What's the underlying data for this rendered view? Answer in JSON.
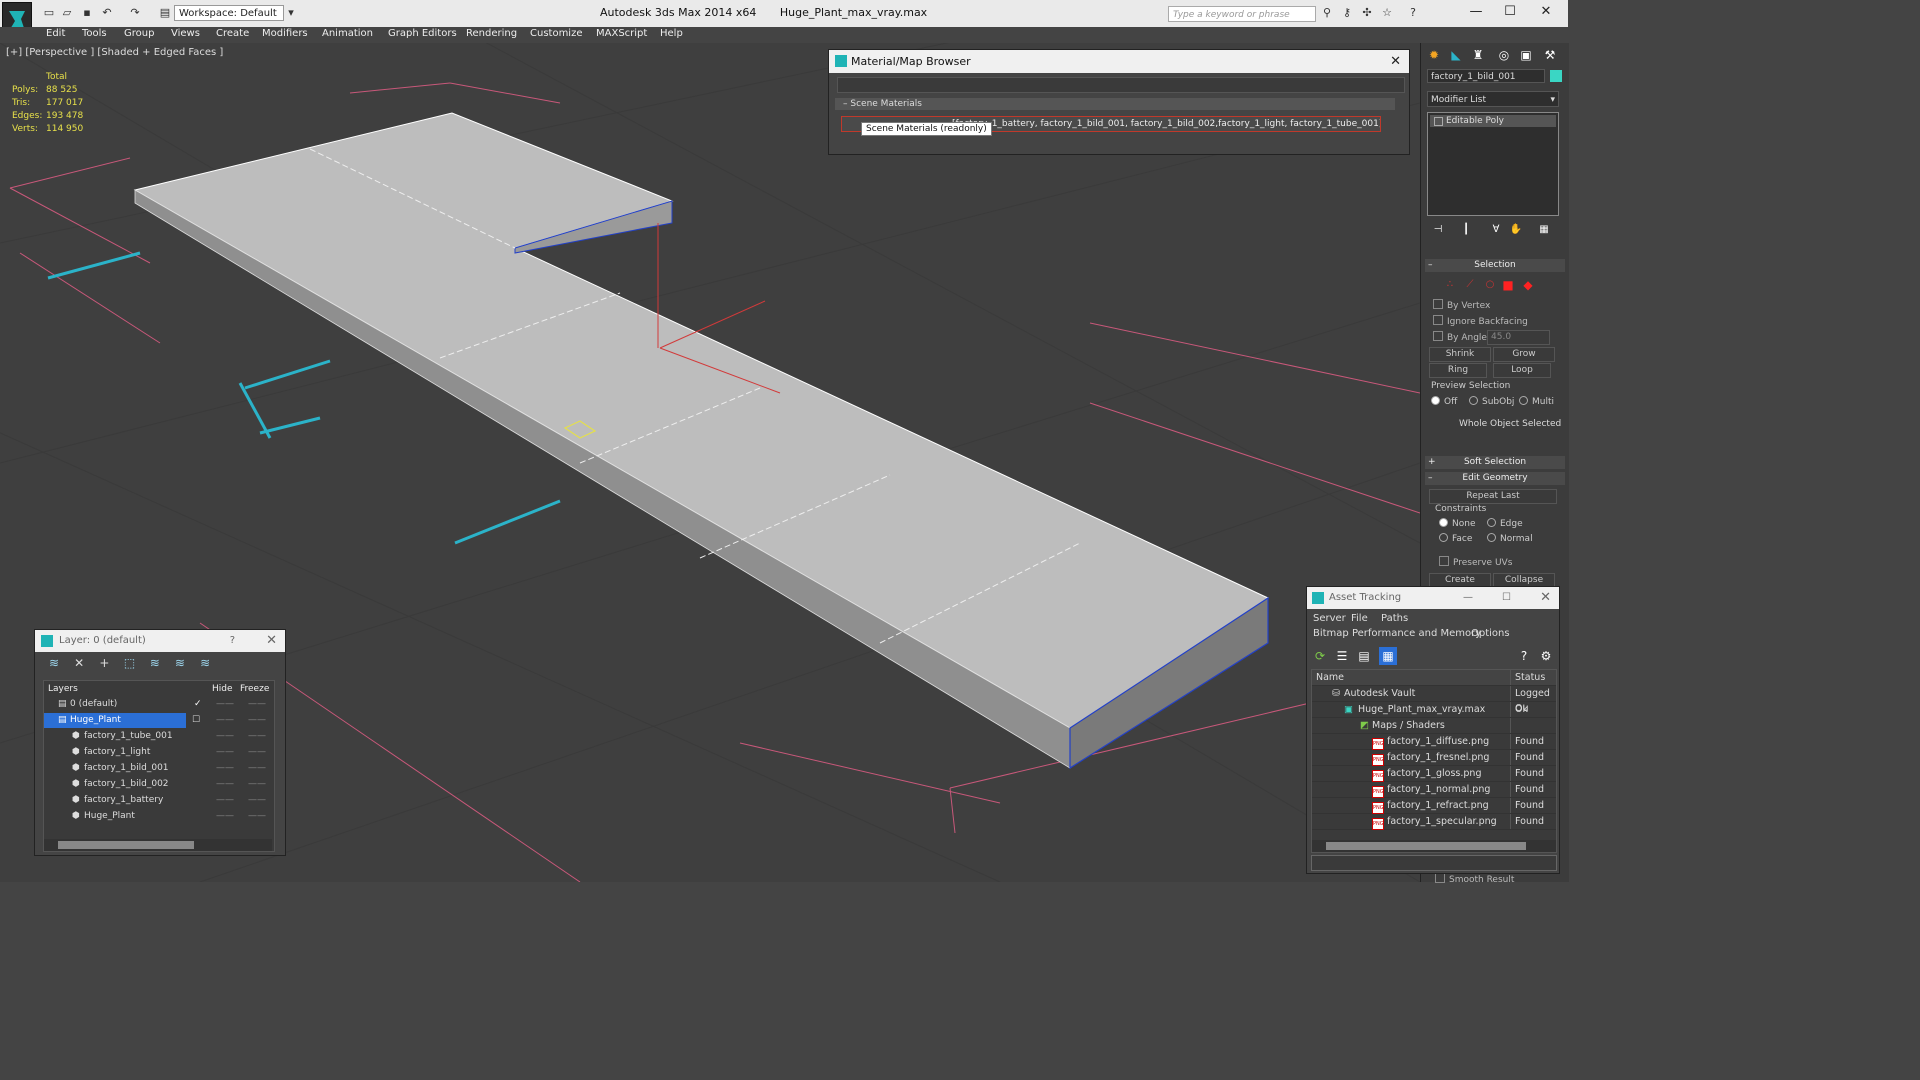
{
  "titlebar": {
    "app_title": "Autodesk 3ds Max  2014 x64",
    "file_title": "Huge_Plant_max_vray.max",
    "workspace": "Workspace: Default",
    "search_placeholder": "Type a keyword or phrase"
  },
  "menu": [
    "Edit",
    "Tools",
    "Group",
    "Views",
    "Create",
    "Modifiers",
    "Animation",
    "Graph Editors",
    "Rendering",
    "Customize",
    "MAXScript",
    "Help"
  ],
  "viewport": {
    "label": "[+] [Perspective ] [Shaded + Edged Faces ]",
    "stats": {
      "header": "Total",
      "rows": [
        {
          "k": "Polys:",
          "v": "88 525"
        },
        {
          "k": "Tris:",
          "v": "177 017"
        },
        {
          "k": "Edges:",
          "v": "193 478"
        },
        {
          "k": "Verts:",
          "v": "114 950"
        }
      ]
    }
  },
  "material_browser": {
    "title": "Material/Map Browser",
    "section": "Scene Materials",
    "row_text": "[factory_1_battery, factory_1_bild_001, factory_1_bild_002,factory_1_light, factory_1_tube_001]",
    "tooltip": "Scene Materials (readonly)"
  },
  "command_panel": {
    "object_name": "factory_1_bild_001",
    "modifier_list": "Modifier List",
    "modifier_stack": [
      "Editable Poly"
    ],
    "selection": {
      "title": "Selection",
      "by_vertex": "By Vertex",
      "ignore_backfacing": "Ignore Backfacing",
      "by_angle": "By Angle:",
      "angle_value": "45.0",
      "shrink": "Shrink",
      "grow": "Grow",
      "ring": "Ring",
      "loop": "Loop",
      "preview_selection": "Preview Selection",
      "off": "Off",
      "subobj": "SubObj",
      "multi": "Multi",
      "status": "Whole Object Selected"
    },
    "soft_selection": "Soft Selection",
    "edit_geometry": {
      "title": "Edit Geometry",
      "repeat_last": "Repeat Last",
      "constraints": "Constraints",
      "none": "None",
      "edge": "Edge",
      "face": "Face",
      "normal": "Normal",
      "preserve_uvs": "Preserve UVs",
      "create": "Create",
      "collapse": "Collapse"
    },
    "smooth_result": "Smooth Result"
  },
  "layer_window": {
    "title": "Layer: 0 (default)",
    "help": "?",
    "columns": {
      "layers": "Layers",
      "hide": "Hide",
      "freeze": "Freeze"
    },
    "rows": [
      {
        "name": "0 (default)",
        "indent": 0
      },
      {
        "name": "Huge_Plant",
        "indent": 0
      },
      {
        "name": "factory_1_tube_001",
        "indent": 1
      },
      {
        "name": "factory_1_light",
        "indent": 1
      },
      {
        "name": "factory_1_bild_001",
        "indent": 1
      },
      {
        "name": "factory_1_bild_002",
        "indent": 1
      },
      {
        "name": "factory_1_battery",
        "indent": 1
      },
      {
        "name": "Huge_Plant",
        "indent": 1
      }
    ],
    "dash": "——"
  },
  "asset_tracking": {
    "title": "Asset Tracking",
    "menu": [
      "Server",
      "File",
      "Paths"
    ],
    "menu2": [
      "Bitmap Performance and Memory",
      "Options"
    ],
    "columns": {
      "name": "Name",
      "status": "Status"
    },
    "rows": [
      {
        "name": "Autodesk Vault",
        "status": "Logged Ou",
        "indent": 1
      },
      {
        "name": "Huge_Plant_max_vray.max",
        "status": "Ok",
        "indent": 2
      },
      {
        "name": "Maps / Shaders",
        "status": "",
        "indent": 3
      },
      {
        "name": "factory_1_diffuse.png",
        "status": "Found",
        "indent": 4
      },
      {
        "name": "factory_1_fresnel.png",
        "status": "Found",
        "indent": 4
      },
      {
        "name": "factory_1_gloss.png",
        "status": "Found",
        "indent": 4
      },
      {
        "name": "factory_1_normal.png",
        "status": "Found",
        "indent": 4
      },
      {
        "name": "factory_1_refract.png",
        "status": "Found",
        "indent": 4
      },
      {
        "name": "factory_1_specular.png",
        "status": "Found",
        "indent": 4
      }
    ]
  },
  "colors": {
    "accent": "#3ad6c4",
    "selection": "#2b6fd6",
    "stats": "#e7e04a"
  }
}
